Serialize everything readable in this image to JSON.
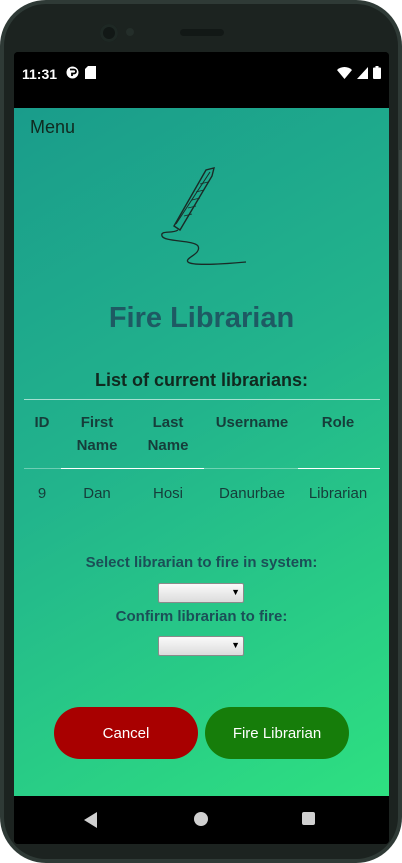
{
  "status": {
    "time": "11:31"
  },
  "menu": {
    "label": "Menu"
  },
  "page": {
    "title": "Fire Librarian",
    "list_heading": "List of current librarians:"
  },
  "table": {
    "headers": {
      "id": "ID",
      "first_name_1": "First",
      "first_name_2": "Name",
      "last_name_1": "Last",
      "last_name_2": "Name",
      "username": "Username",
      "role": "Role"
    },
    "rows": [
      {
        "id": "9",
        "first_name": "Dan",
        "last_name": "Hosi",
        "username": "Danurbae",
        "role": "Librarian"
      }
    ]
  },
  "form": {
    "select_label": "Select librarian to fire in system:",
    "confirm_label": "Confirm librarian to fire:",
    "select_value": "",
    "confirm_value": ""
  },
  "buttons": {
    "cancel": "Cancel",
    "fire": "Fire Librarian"
  },
  "colors": {
    "cancel_button": "#a80000",
    "fire_button": "#167d0a",
    "title": "#1e5a63"
  },
  "icons": {
    "logo": "quill-pen-icon",
    "nav_back": "back-triangle-icon",
    "nav_home": "home-circle-icon",
    "nav_recent": "recents-square-icon"
  }
}
